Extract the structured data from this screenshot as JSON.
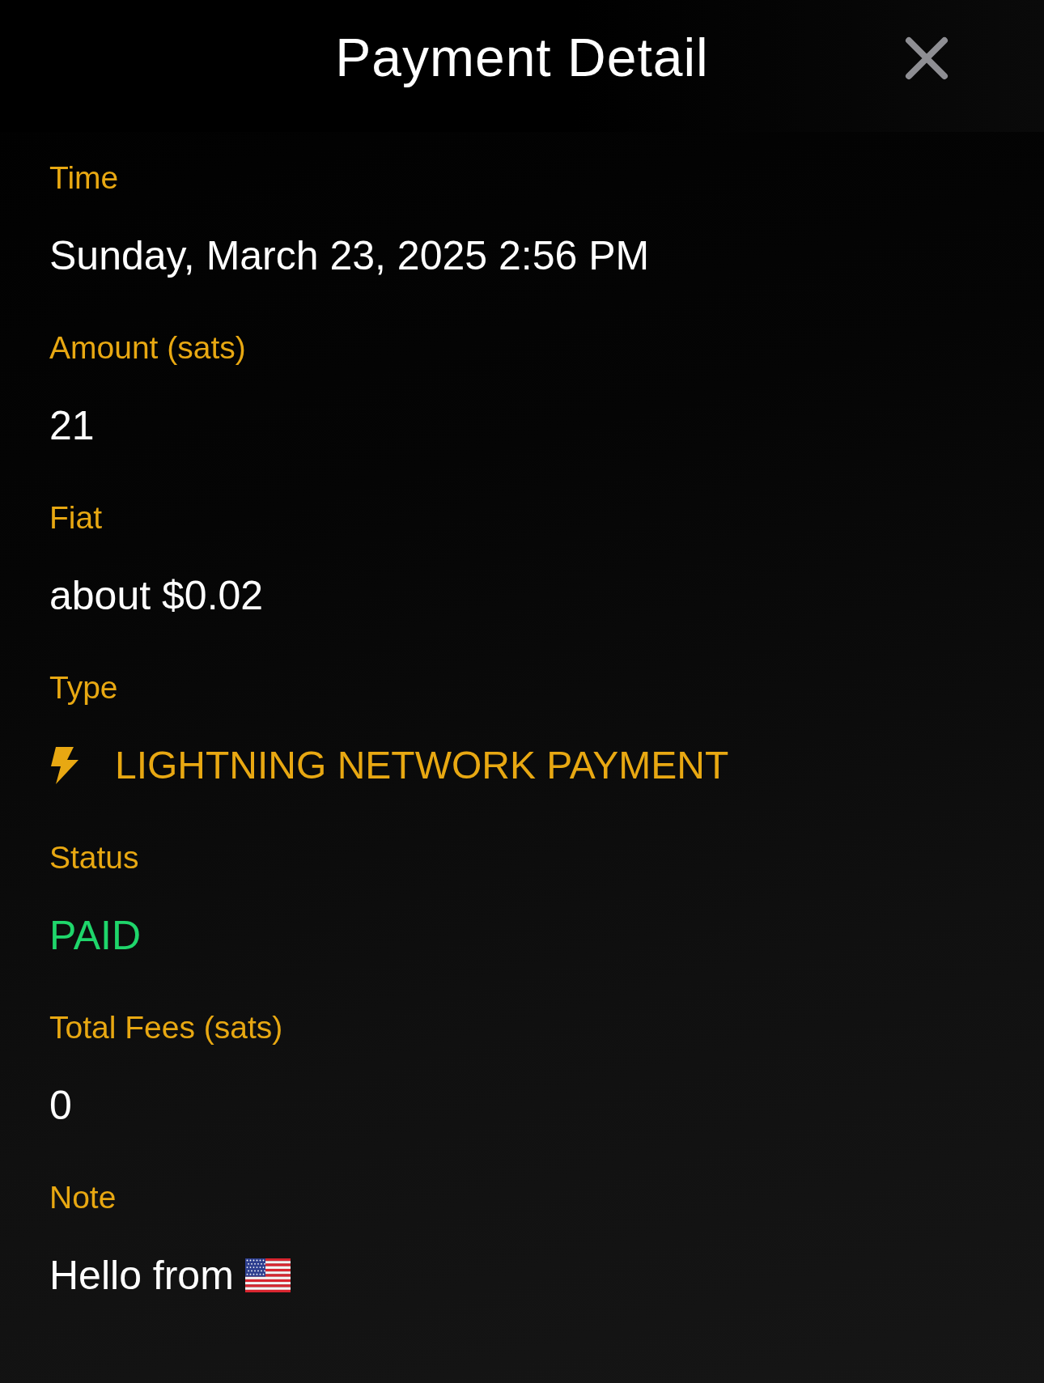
{
  "header": {
    "title": "Payment Detail"
  },
  "fields": [
    {
      "label": "Time",
      "value": "Sunday, March 23, 2025 2:56 PM",
      "kind": "plain"
    },
    {
      "label": "Amount (sats)",
      "value": "21",
      "kind": "plain"
    },
    {
      "label": "Fiat",
      "value": "about $0.02",
      "kind": "plain"
    },
    {
      "label": "Type",
      "value": "LIGHTNING NETWORK PAYMENT",
      "kind": "lightning"
    },
    {
      "label": "Status",
      "value": "PAID",
      "kind": "status"
    },
    {
      "label": "Total Fees (sats)",
      "value": "0",
      "kind": "plain"
    },
    {
      "label": "Note",
      "value": "Hello from",
      "kind": "flag"
    }
  ]
}
